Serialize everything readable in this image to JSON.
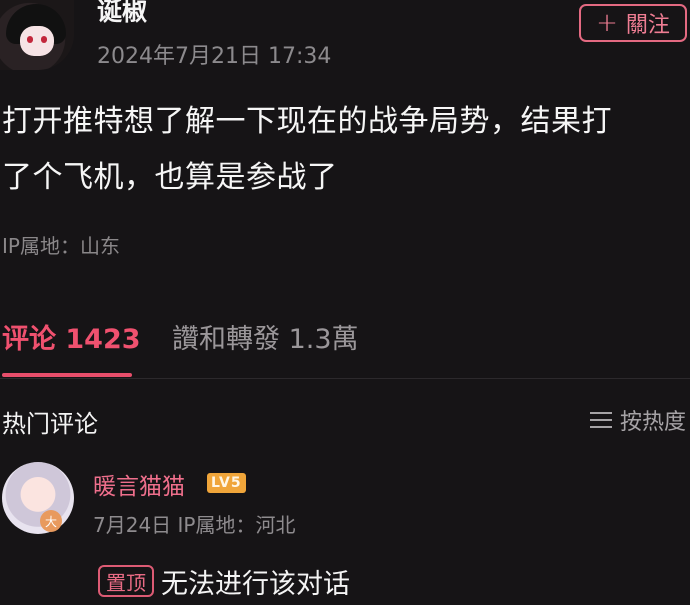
{
  "post": {
    "username": "诞椒",
    "time": "2024年7月21日 17:34",
    "follow_label": "關注",
    "text_line1": "打开推特想了解一下现在的战争局势，结果打",
    "text_line2": "了个飞机，也算是参战了",
    "ip": "IP属地：山东"
  },
  "tabs": {
    "comments_label": "评论 1423",
    "reposts_label": "讚和轉發 1.3萬"
  },
  "comments_section": {
    "title": "热门评论",
    "sort_label": "按热度"
  },
  "comment": {
    "username": "暖言猫猫",
    "level": "LV5",
    "avatar_badge": "大",
    "meta": "7月24日 IP属地：河北",
    "pin_label": "置顶",
    "text": "无法进行该对话"
  },
  "colors": {
    "background": "#161416",
    "accent": "#f0516f"
  }
}
